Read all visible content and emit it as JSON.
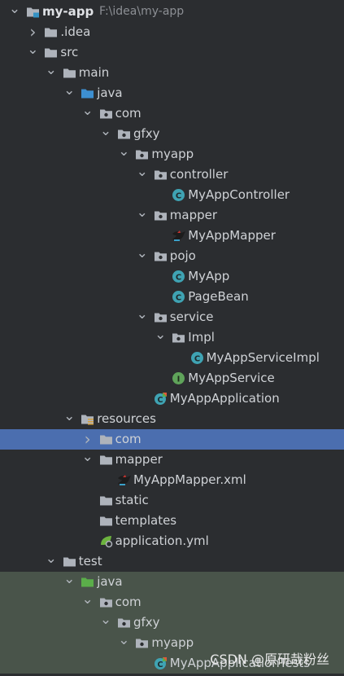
{
  "project": {
    "name": "my-app",
    "path": "F:\\idea\\my-app"
  },
  "tree": [
    {
      "label": "my-app",
      "path": "F:\\idea\\my-app",
      "depth": 0,
      "arrow": "down",
      "icon": "project-folder-icon",
      "bold": true
    },
    {
      "label": ".idea",
      "depth": 1,
      "arrow": "right",
      "icon": "folder-icon"
    },
    {
      "label": "src",
      "depth": 1,
      "arrow": "down",
      "icon": "folder-icon"
    },
    {
      "label": "main",
      "depth": 2,
      "arrow": "down",
      "icon": "folder-icon"
    },
    {
      "label": "java",
      "depth": 3,
      "arrow": "down",
      "icon": "source-root-folder-icon"
    },
    {
      "label": "com",
      "depth": 4,
      "arrow": "down",
      "icon": "package-icon"
    },
    {
      "label": "gfxy",
      "depth": 5,
      "arrow": "down",
      "icon": "package-icon"
    },
    {
      "label": "myapp",
      "depth": 6,
      "arrow": "down",
      "icon": "package-icon"
    },
    {
      "label": "controller",
      "depth": 7,
      "arrow": "down",
      "icon": "package-icon"
    },
    {
      "label": "MyAppController",
      "depth": 8,
      "arrow": "",
      "icon": "class-icon"
    },
    {
      "label": "mapper",
      "depth": 7,
      "arrow": "down",
      "icon": "package-icon"
    },
    {
      "label": "MyAppMapper",
      "depth": 8,
      "arrow": "",
      "icon": "mybatis-bird-icon"
    },
    {
      "label": "pojo",
      "depth": 7,
      "arrow": "down",
      "icon": "package-icon"
    },
    {
      "label": "MyApp",
      "depth": 8,
      "arrow": "",
      "icon": "class-icon"
    },
    {
      "label": "PageBean",
      "depth": 8,
      "arrow": "",
      "icon": "class-icon"
    },
    {
      "label": "service",
      "depth": 7,
      "arrow": "down",
      "icon": "package-icon"
    },
    {
      "label": "Impl",
      "depth": 8,
      "arrow": "down",
      "icon": "package-icon"
    },
    {
      "label": "MyAppServiceImpl",
      "depth": 9,
      "arrow": "",
      "icon": "class-icon"
    },
    {
      "label": "MyAppService",
      "depth": 8,
      "arrow": "",
      "icon": "interface-icon"
    },
    {
      "label": "MyAppApplication",
      "depth": 7,
      "arrow": "",
      "icon": "spring-boot-class-icon"
    },
    {
      "label": "resources",
      "depth": 3,
      "arrow": "down",
      "icon": "resources-folder-icon"
    },
    {
      "label": "com",
      "depth": 4,
      "arrow": "right",
      "icon": "folder-icon",
      "selected": true
    },
    {
      "label": "mapper",
      "depth": 4,
      "arrow": "down",
      "icon": "folder-icon"
    },
    {
      "label": "MyAppMapper.xml",
      "depth": 5,
      "arrow": "",
      "icon": "mybatis-bird-icon"
    },
    {
      "label": "static",
      "depth": 4,
      "arrow": "",
      "icon": "folder-icon"
    },
    {
      "label": "templates",
      "depth": 4,
      "arrow": "",
      "icon": "folder-icon"
    },
    {
      "label": "application.yml",
      "depth": 4,
      "arrow": "",
      "icon": "spring-leaf-icon"
    },
    {
      "label": "test",
      "depth": 2,
      "arrow": "down",
      "icon": "folder-icon"
    },
    {
      "label": "java",
      "depth": 3,
      "arrow": "down",
      "icon": "test-root-folder-icon",
      "test": true
    },
    {
      "label": "com",
      "depth": 4,
      "arrow": "down",
      "icon": "package-icon",
      "test": true
    },
    {
      "label": "gfxy",
      "depth": 5,
      "arrow": "down",
      "icon": "package-icon",
      "test": true
    },
    {
      "label": "myapp",
      "depth": 6,
      "arrow": "down",
      "icon": "package-icon",
      "test": true
    },
    {
      "label": "MyAppApplicationTests",
      "depth": 7,
      "arrow": "",
      "icon": "spring-boot-class-icon",
      "test": true
    }
  ],
  "watermark": "CSDN @原研哉粉丝",
  "colors": {
    "background": "#2b2d30",
    "selection": "#4b6eaf",
    "test_background": "#49544a",
    "folder": "#aeb3bb",
    "source_root": "#3d8fd1",
    "test_root": "#5bae4a",
    "class_icon": "#3fa3b3",
    "interface_icon": "#5fa35a"
  }
}
